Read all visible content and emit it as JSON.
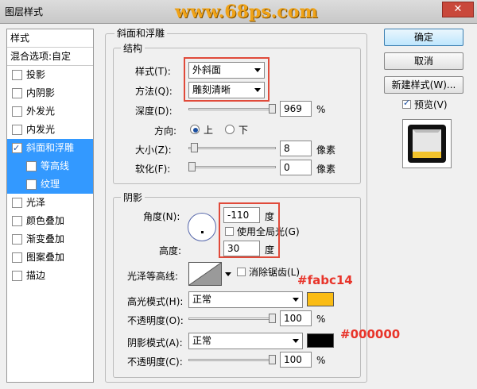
{
  "window": {
    "title": "图层样式",
    "close_label": "✕"
  },
  "watermark": "www.68ps.com",
  "left_panel": {
    "items": [
      {
        "label": "样式",
        "checkbox": false,
        "checked": false,
        "selected": false,
        "sub": false
      },
      {
        "label": "混合选项:自定",
        "checkbox": false,
        "checked": false,
        "selected": false,
        "sub": false
      },
      {
        "label": "投影",
        "checkbox": true,
        "checked": false,
        "selected": false,
        "sub": false
      },
      {
        "label": "内阴影",
        "checkbox": true,
        "checked": false,
        "selected": false,
        "sub": false
      },
      {
        "label": "外发光",
        "checkbox": true,
        "checked": false,
        "selected": false,
        "sub": false
      },
      {
        "label": "内发光",
        "checkbox": true,
        "checked": false,
        "selected": false,
        "sub": false
      },
      {
        "label": "斜面和浮雕",
        "checkbox": true,
        "checked": true,
        "selected": true,
        "sub": false
      },
      {
        "label": "等高线",
        "checkbox": true,
        "checked": false,
        "selected": false,
        "sub": true
      },
      {
        "label": "纹理",
        "checkbox": true,
        "checked": false,
        "selected": false,
        "sub": true
      },
      {
        "label": "光泽",
        "checkbox": true,
        "checked": false,
        "selected": false,
        "sub": false
      },
      {
        "label": "颜色叠加",
        "checkbox": true,
        "checked": false,
        "selected": false,
        "sub": false
      },
      {
        "label": "渐变叠加",
        "checkbox": true,
        "checked": false,
        "selected": false,
        "sub": false
      },
      {
        "label": "图案叠加",
        "checkbox": true,
        "checked": false,
        "selected": false,
        "sub": false
      },
      {
        "label": "描边",
        "checkbox": true,
        "checked": false,
        "selected": false,
        "sub": false
      }
    ]
  },
  "bevel": {
    "section_title": "斜面和浮雕",
    "structure": {
      "title": "结构",
      "style_label": "样式(T):",
      "style_value": "外斜面",
      "technique_label": "方法(Q):",
      "technique_value": "雕刻清晰",
      "depth_label": "深度(D):",
      "depth_value": "969",
      "depth_unit": "%",
      "depth_level": 1.0,
      "direction_label": "方向:",
      "direction_up": "上",
      "direction_down": "下",
      "size_label": "大小(Z):",
      "size_value": "8",
      "size_unit": "像素",
      "size_level": 0.03,
      "soften_label": "软化(F):",
      "soften_value": "0",
      "soften_unit": "像素",
      "soften_level": 0.0
    },
    "shading": {
      "title": "阴影",
      "angle_label": "角度(N):",
      "angle_value": "-110",
      "angle_unit": "度",
      "global_light_label": "使用全局光(G)",
      "altitude_label": "高度:",
      "altitude_value": "30",
      "altitude_unit": "度",
      "gloss_label": "光泽等高线:",
      "anti_alias_label": "消除锯齿(L)",
      "highlight_mode_label": "高光模式(H):",
      "highlight_mode_value": "正常",
      "highlight_color": "#fabc14",
      "highlight_opacity_label": "不透明度(O):",
      "highlight_opacity_value": "100",
      "highlight_opacity_unit": "%",
      "shadow_mode_label": "阴影模式(A):",
      "shadow_mode_value": "正常",
      "shadow_color": "#000000",
      "shadow_opacity_label": "不透明度(C):",
      "shadow_opacity_value": "100",
      "shadow_opacity_unit": "%"
    }
  },
  "annotations": {
    "highlight": "#fabc14",
    "shadow": "#000000"
  },
  "right_buttons": {
    "ok": "确定",
    "cancel": "取消",
    "new_style": "新建样式(W)...",
    "preview_label": "预览(V)",
    "preview_checked": true
  },
  "colors": {
    "accent_red": "#e04a3a",
    "selection": "#3399ff",
    "annotation": "#e8342a"
  }
}
